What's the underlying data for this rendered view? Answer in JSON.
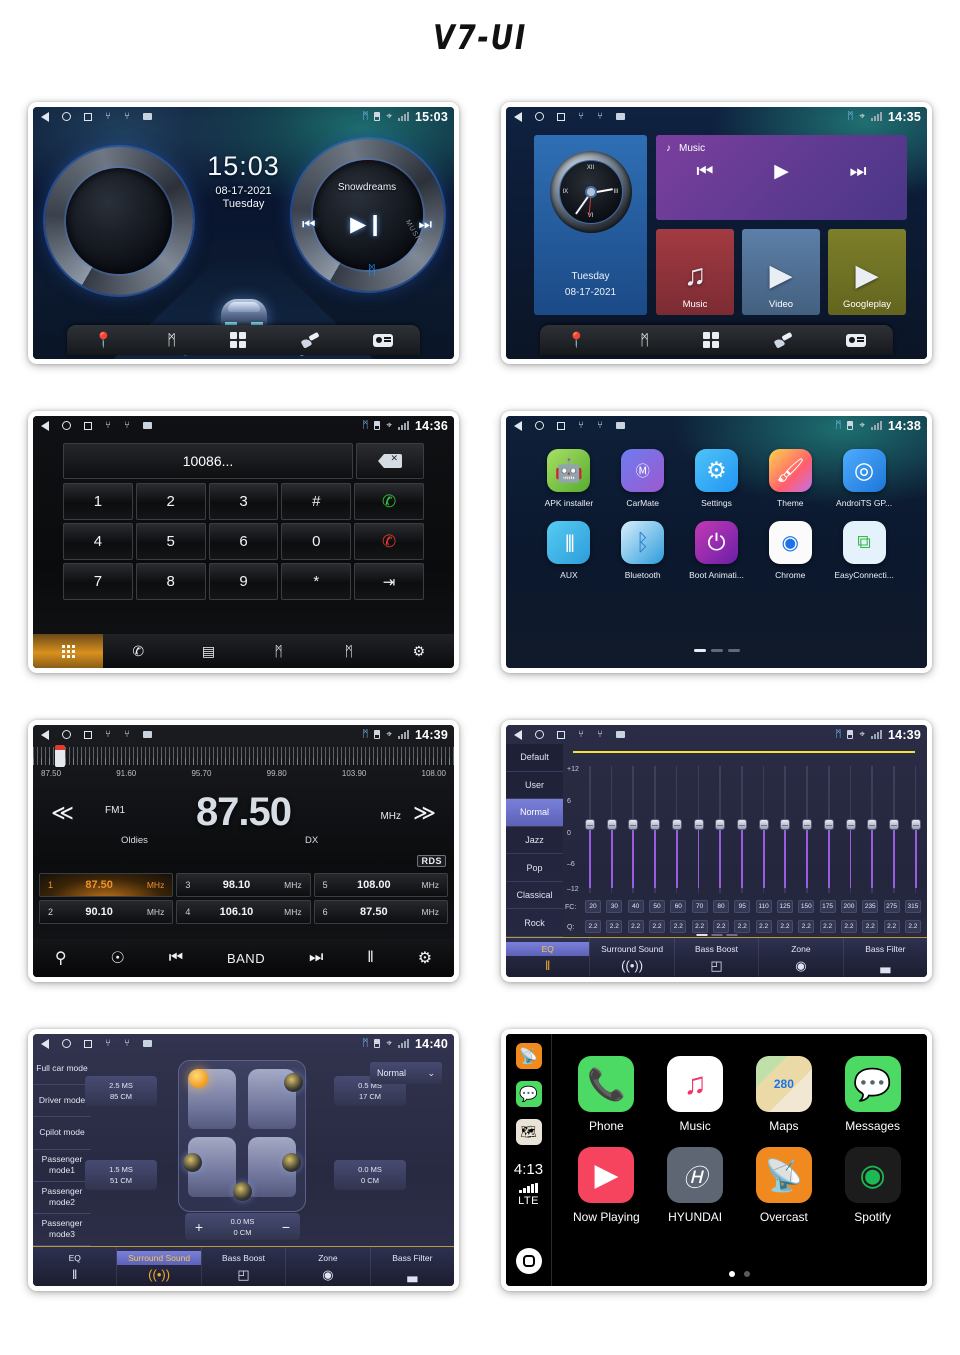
{
  "title": "V7-UI",
  "panels": {
    "home": {
      "status": {
        "time": "15:03"
      },
      "clock": "15:03",
      "date": "08-17-2021",
      "weekday": "Tuesday",
      "track": "Snowdreams",
      "music_label": "MUSIC",
      "controls": {
        "prev": "⏮",
        "playpause": "▶❙",
        "next": "⏭"
      },
      "bluetooth_icon": "ᛗ",
      "dock": [
        {
          "name": "navigation",
          "icon": "•"
        },
        {
          "name": "bluetooth",
          "icon": "ᛗ"
        },
        {
          "name": "apps",
          "icon": "grid"
        },
        {
          "name": "theme",
          "icon": "brush"
        },
        {
          "name": "radio",
          "icon": "radio"
        }
      ]
    },
    "widgets": {
      "status": {
        "time": "14:35"
      },
      "weekday": "Tuesday",
      "date": "08-17-2021",
      "clock_numerals": {
        "xii": "XII",
        "iii": "III",
        "vi": "VI",
        "ix": "IX"
      },
      "music_widget": {
        "title": "Music",
        "note_icon": "♪",
        "prev": "⏮",
        "play": "▶",
        "next": "⏭"
      },
      "tiles": [
        {
          "label": "Music",
          "glyph": "♫"
        },
        {
          "label": "Video",
          "glyph": "▶"
        },
        {
          "label": "Googleplay",
          "glyph": "▶"
        }
      ]
    },
    "dialer": {
      "status": {
        "time": "14:36"
      },
      "number": "10086...",
      "keys": [
        "1",
        "2",
        "3",
        "#",
        "call",
        "4",
        "5",
        "6",
        "0",
        "end",
        "7",
        "8",
        "9",
        "*",
        "transfer"
      ],
      "call_icon": "✆",
      "end_icon": "✆",
      "transfer_icon": "⇥",
      "nav": [
        {
          "name": "keypad",
          "label": "keypad"
        },
        {
          "name": "call-log",
          "icon": "✆"
        },
        {
          "name": "contacts",
          "icon": "▤"
        },
        {
          "name": "bt-headset",
          "icon": "ᛗ"
        },
        {
          "name": "bt-phone",
          "icon": "ᛗ"
        },
        {
          "name": "settings",
          "icon": "⚙"
        }
      ]
    },
    "apps": {
      "status": {
        "time": "14:38"
      },
      "items": [
        {
          "label": "APK installer",
          "glyph": "▢",
          "color": "#8ed14e"
        },
        {
          "label": "CarMate",
          "glyph": "M",
          "color": "#7b5ce0"
        },
        {
          "label": "Settings",
          "glyph": "⚙",
          "color": "#3aa6e8"
        },
        {
          "label": "Theme",
          "glyph": "✎",
          "color": "#f2b23a"
        },
        {
          "label": "AndroiTS GP...",
          "glyph": "◎",
          "color": "#2f8fe0"
        },
        {
          "label": "AUX",
          "glyph": "║",
          "color": "#37b8e8"
        },
        {
          "label": "Bluetooth",
          "glyph": "ᛗ",
          "color": "#2a8fe0"
        },
        {
          "label": "Boot Animati...",
          "glyph": "⏻",
          "color": "#b43ca8"
        },
        {
          "label": "Chrome",
          "glyph": "●",
          "color": "#f6f6f6"
        },
        {
          "label": "EasyConnecti...",
          "glyph": "❐",
          "color": "#d6ecf8"
        }
      ]
    },
    "radio": {
      "status": {
        "time": "14:39"
      },
      "scale_ticks": [
        "87.50",
        "91.60",
        "95.70",
        "99.80",
        "103.90",
        "108.00"
      ],
      "band": "FM1",
      "frequency": "87.50",
      "unit": "MHz",
      "genre": "Oldies",
      "sensitivity": "DX",
      "rds": "RDS",
      "arrow_prev": "≪",
      "arrow_next": "≫",
      "presets": [
        {
          "index": "1",
          "value": "87.50",
          "unit": "MHz",
          "active": true
        },
        {
          "index": "2",
          "value": "90.10",
          "unit": "MHz",
          "active": false
        },
        {
          "index": "3",
          "value": "98.10",
          "unit": "MHz",
          "active": false
        },
        {
          "index": "4",
          "value": "106.10",
          "unit": "MHz",
          "active": false
        },
        {
          "index": "5",
          "value": "108.00",
          "unit": "MHz",
          "active": false
        },
        {
          "index": "6",
          "value": "87.50",
          "unit": "MHz",
          "active": false
        }
      ],
      "toolbar": {
        "search": "⚲",
        "local": "☉",
        "prev": "⏮",
        "band_label": "BAND",
        "next": "⏭",
        "eq": "‖",
        "settings": "⚙"
      }
    },
    "eq": {
      "status": {
        "time": "14:39"
      },
      "presets": [
        "Default",
        "User",
        "Normal",
        "Jazz",
        "Pop",
        "Classical",
        "Rock"
      ],
      "selected_preset": "Normal",
      "axis_labels": [
        "+12",
        "6",
        "0",
        "–6",
        "–12"
      ],
      "fc_label": "FC:",
      "q_label": "Q:",
      "fc_values": [
        "20",
        "30",
        "40",
        "50",
        "60",
        "70",
        "80",
        "95",
        "110",
        "125",
        "150",
        "175",
        "200",
        "235",
        "275",
        "315"
      ],
      "q_values": [
        "2.2",
        "2.2",
        "2.2",
        "2.2",
        "2.2",
        "2.2",
        "2.2",
        "2.2",
        "2.2",
        "2.2",
        "2.2",
        "2.2",
        "2.2",
        "2.2",
        "2.2",
        "2.2"
      ],
      "tabs": [
        {
          "label": "EQ",
          "icon": "‖",
          "selected": true
        },
        {
          "label": "Surround Sound",
          "icon": "((•))",
          "selected": false
        },
        {
          "label": "Bass Boost",
          "icon": "◰",
          "selected": false
        },
        {
          "label": "Zone",
          "icon": "◉",
          "selected": false
        },
        {
          "label": "Bass Filter",
          "icon": "▃",
          "selected": false
        }
      ]
    },
    "surround": {
      "status": {
        "time": "14:40"
      },
      "modes": [
        "Full car mode",
        "Driver mode",
        "Cpilot mode",
        "Passenger mode1",
        "Passenger mode2",
        "Passenger mode3"
      ],
      "dropdown": {
        "value": "Normal",
        "caret": "⌄"
      },
      "delays": [
        {
          "ms": "2.5 MS",
          "cm": "85 CM"
        },
        {
          "ms": "0.5 MS",
          "cm": "17 CM"
        },
        {
          "ms": "1.5 MS",
          "cm": "51 CM"
        },
        {
          "ms": "0.0 MS",
          "cm": "0 CM"
        }
      ],
      "stepper": {
        "plus": "+",
        "minus": "−",
        "ms": "0.0 MS",
        "cm": "0 CM"
      },
      "tabs": [
        {
          "label": "EQ",
          "icon": "‖",
          "selected": false
        },
        {
          "label": "Surround Sound",
          "icon": "((•))",
          "selected": true
        },
        {
          "label": "Bass Boost",
          "icon": "◰",
          "selected": false
        },
        {
          "label": "Zone",
          "icon": "◉",
          "selected": false
        },
        {
          "label": "Bass Filter",
          "icon": "▃",
          "selected": false
        }
      ]
    },
    "carplay": {
      "sidebar": {
        "icons": [
          {
            "name": "overcast",
            "glyph": "◎",
            "color": "#f08a1e"
          },
          {
            "name": "messages",
            "glyph": "●",
            "color": "#4cd964"
          },
          {
            "name": "maps",
            "glyph": "▣",
            "color": "#e9e4d6"
          }
        ],
        "time": "4:13",
        "network": "LTE",
        "home_icon": "home"
      },
      "apps": [
        {
          "label": "Phone",
          "glyph": "✆",
          "color": "#4cd964"
        },
        {
          "label": "Music",
          "glyph": "♫",
          "color": "#ffffff"
        },
        {
          "label": "Maps",
          "glyph": "280",
          "color": "#e9e4d6"
        },
        {
          "label": "Messages",
          "glyph": "●",
          "color": "#4cd964"
        },
        {
          "label": "Now Playing",
          "glyph": "▶",
          "color": "#f6445f"
        },
        {
          "label": "HYUNDAI",
          "glyph": "H",
          "color": "#5d6672"
        },
        {
          "label": "Overcast",
          "glyph": "◎",
          "color": "#f08a1e"
        },
        {
          "label": "Spotify",
          "glyph": "♬",
          "color": "#1c1c1c"
        }
      ],
      "page_dots": 2,
      "active_dot": 0
    }
  }
}
